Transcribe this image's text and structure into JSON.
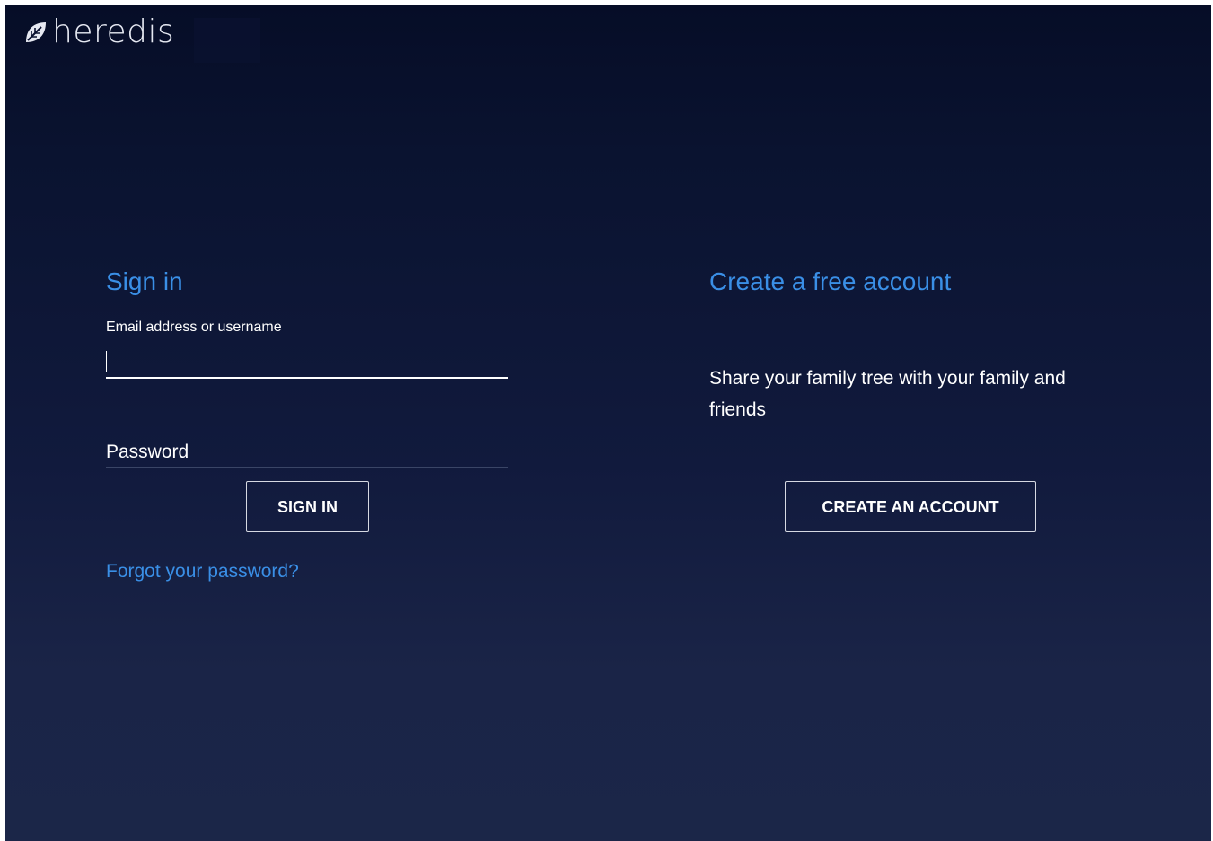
{
  "brand": {
    "name": "heredis",
    "logo_icon": "leaf-icon"
  },
  "signin": {
    "heading": "Sign in",
    "email_label": "Email address or username",
    "email_value": "",
    "password_label": "Password",
    "submit_label": "SIGN IN",
    "forgot_label": "Forgot your password?"
  },
  "create": {
    "heading": "Create a free account",
    "description": "Share your family tree with your family and friends",
    "button_label": "CREATE AN ACCOUNT"
  },
  "colors": {
    "accent": "#3a8fe6",
    "background_top": "#060d27",
    "background_bottom": "#1b2648",
    "text": "#ffffff"
  }
}
